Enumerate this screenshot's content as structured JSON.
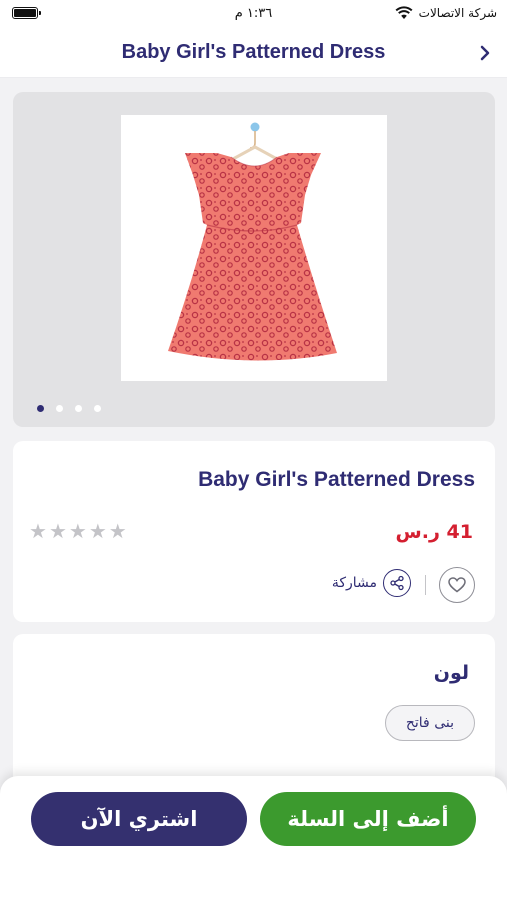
{
  "status_bar": {
    "time": "١:٣٦ م",
    "carrier": "شركة الاتصالات"
  },
  "header": {
    "title": "Baby Girl's Patterned Dress"
  },
  "gallery": {
    "image_count": 4,
    "active_index": 0
  },
  "product": {
    "name": "Baby Girl's Patterned Dress",
    "price": "41 ر.س",
    "rating": 0,
    "share_label": "مشاركة"
  },
  "color_section": {
    "title": "لون",
    "selected": "بنى فاتح"
  },
  "actions": {
    "add_to_cart": "أضف إلى السلة",
    "buy_now": "اشتري الآن"
  },
  "colors": {
    "brand": "#2f2c73",
    "price": "#d41f30",
    "cart_button": "#3c9a2e",
    "buy_button": "#34306f",
    "dress": "#f0786e"
  }
}
